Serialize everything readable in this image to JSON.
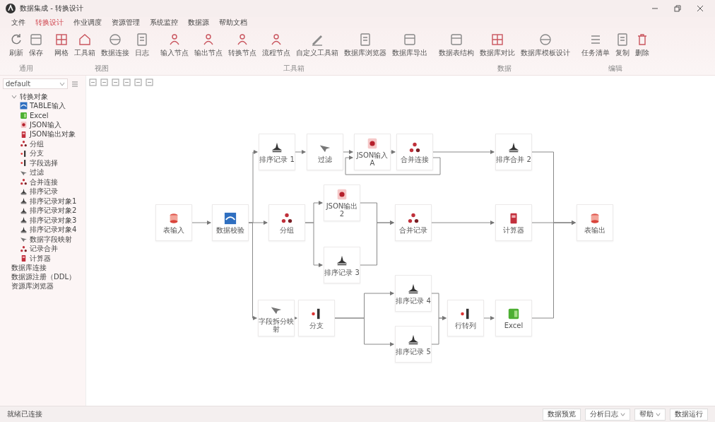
{
  "window": {
    "title": "数据集成 - 转换设计"
  },
  "menu": [
    {
      "label": "文件",
      "selected": false
    },
    {
      "label": "转换设计",
      "selected": true
    },
    {
      "label": "作业调度",
      "selected": false
    },
    {
      "label": "资源管理",
      "selected": false
    },
    {
      "label": "系统监控",
      "selected": false
    },
    {
      "label": "数据源",
      "selected": false
    },
    {
      "label": "帮助文档",
      "selected": false
    }
  ],
  "toolbar_groups": [
    {
      "label": "通用",
      "buttons": [
        {
          "label": "刷新",
          "kind": "refresh"
        },
        {
          "label": "保存",
          "kind": "box"
        }
      ]
    },
    {
      "label": "视图",
      "buttons": [
        {
          "label": "网格",
          "kind": "grid"
        },
        {
          "label": "工具箱",
          "kind": "home"
        },
        {
          "label": "数据连接",
          "kind": "globe"
        },
        {
          "label": "日志",
          "kind": "doc"
        }
      ]
    },
    {
      "label": "工具箱",
      "buttons": [
        {
          "label": "输入节点",
          "kind": "person"
        },
        {
          "label": "输出节点",
          "kind": "person"
        },
        {
          "label": "转换节点",
          "kind": "person"
        },
        {
          "label": "流程节点",
          "kind": "person"
        },
        {
          "label": "自定义工具箱",
          "kind": "pen"
        },
        {
          "label": "数据库浏览器",
          "kind": "doc"
        },
        {
          "label": "数据库导出",
          "kind": "box"
        }
      ]
    },
    {
      "label": "数据",
      "buttons": [
        {
          "label": "数据表结构",
          "kind": "box"
        },
        {
          "label": "数据库对比",
          "kind": "grid"
        },
        {
          "label": "数据库模板设计",
          "kind": "globe"
        }
      ]
    },
    {
      "label": "编辑",
      "buttons": [
        {
          "label": "任务清单",
          "kind": "list"
        },
        {
          "label": "复制",
          "kind": "doc"
        },
        {
          "label": "删除",
          "kind": "trash"
        }
      ]
    }
  ],
  "sidebar": {
    "search": {
      "value": "default"
    },
    "tree": [
      {
        "label": "转换对象",
        "expanded": true,
        "children": [
          {
            "label": "TABLE输入",
            "kind": "wave"
          },
          {
            "label": "Excel",
            "kind": "excel"
          },
          {
            "label": "JSON输入",
            "kind": "json"
          },
          {
            "label": "JSON输出对象",
            "kind": "calc"
          },
          {
            "label": "分组",
            "kind": "dots"
          },
          {
            "label": "分支",
            "kind": "branch"
          },
          {
            "label": "字段选择",
            "kind": "branch"
          },
          {
            "label": "过滤",
            "kind": "filter"
          },
          {
            "label": "合并连接",
            "kind": "dots"
          },
          {
            "label": "排序记录",
            "kind": "sort"
          },
          {
            "label": "排序记录对象1",
            "kind": "sort"
          },
          {
            "label": "排序记录对象2",
            "kind": "sort"
          },
          {
            "label": "排序记录对象3",
            "kind": "sort"
          },
          {
            "label": "排序记录对象4",
            "kind": "sort"
          },
          {
            "label": "数据字段映射",
            "kind": "filter"
          },
          {
            "label": "记录合并",
            "kind": "dots"
          },
          {
            "label": "计算器",
            "kind": "calc"
          }
        ]
      },
      {
        "label": "数据库连接"
      },
      {
        "label": "数据源注册（DDL）"
      },
      {
        "label": "资源库浏览器"
      }
    ]
  },
  "canvas": {
    "nodes": [
      {
        "label": "表输入",
        "kind": "db"
      },
      {
        "label": "数据校验",
        "kind": "wave"
      },
      {
        "label": "排序记录 1",
        "kind": "sort"
      },
      {
        "label": "过滤",
        "kind": "filter"
      },
      {
        "label": "JSON输入 A",
        "kind": "json"
      },
      {
        "label": "合并连接",
        "kind": "dots"
      },
      {
        "label": "排序合并 2",
        "kind": "sort"
      },
      {
        "label": "分组",
        "kind": "dots"
      },
      {
        "label": "JSON输出 2",
        "kind": "json"
      },
      {
        "label": "排序记录 3",
        "kind": "sort"
      },
      {
        "label": "合并记录",
        "kind": "dots"
      },
      {
        "label": "计算器",
        "kind": "calc"
      },
      {
        "label": "表输出",
        "kind": "db"
      },
      {
        "label": "字段拆分映射",
        "kind": "filter"
      },
      {
        "label": "分支",
        "kind": "branch"
      },
      {
        "label": "排序记录 4",
        "kind": "sort"
      },
      {
        "label": "排序记录 5",
        "kind": "sort"
      },
      {
        "label": "行转列",
        "kind": "branch"
      },
      {
        "label": "Excel",
        "kind": "excel"
      }
    ]
  },
  "status_bar": {
    "text": "就绪已连接",
    "buttons": [
      {
        "label": "数据预览",
        "dropdown": false
      },
      {
        "label": "分析日志",
        "dropdown": true
      },
      {
        "label": "帮助",
        "dropdown": true
      },
      {
        "label": "数据运行",
        "dropdown": false
      }
    ]
  }
}
